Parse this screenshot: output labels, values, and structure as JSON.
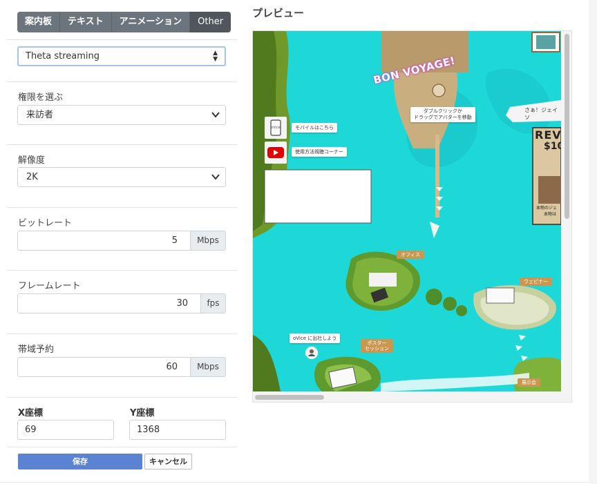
{
  "tabs": [
    {
      "label": "案内板"
    },
    {
      "label": "テキスト"
    },
    {
      "label": "アニメーション"
    },
    {
      "label": "Other"
    }
  ],
  "stream_type": {
    "value": "Theta streaming"
  },
  "permission": {
    "label": "権限を選ぶ",
    "value": "来訪者"
  },
  "resolution": {
    "label": "解像度",
    "value": "2K"
  },
  "bitrate": {
    "label": "ビットレート",
    "value": "5",
    "unit": "Mbps"
  },
  "framerate": {
    "label": "フレームレート",
    "value": "30",
    "unit": "fps"
  },
  "bandwidth": {
    "label": "帯域予約",
    "value": "60",
    "unit": "Mbps"
  },
  "coords": {
    "x_label": "X座標",
    "x_value": "69",
    "y_label": "Y座標",
    "y_value": "1368"
  },
  "actions": {
    "save": "保存",
    "cancel": "キャンセル"
  },
  "preview": {
    "title": "プレビュー",
    "bon_voyage": "BON VOYAGE!",
    "move_hint_1": "ダブルクリックか",
    "move_hint_2": "ドラッグでアバターを移動",
    "mobile_label": "モバイルはこちら",
    "howto_label": "使用方法視聴コーナー",
    "phone_text": "oVice",
    "banner_text": "さぁ！ジェイソ",
    "poster_title": "REV",
    "poster_amount": "$10",
    "poster_line1": "本物のジェ",
    "poster_line2": "本物は",
    "office_sign": "オフィス",
    "webinar_sign": "ウェビナー",
    "poster_session_1": "ポスター",
    "poster_session_2": "セッション",
    "ovice_join": "oVice に出社しよう",
    "exhibition_sign": "展示会"
  },
  "colors": {
    "sea": "#1ed8d8",
    "save": "#5b83d3",
    "tab": "#6c757d"
  }
}
